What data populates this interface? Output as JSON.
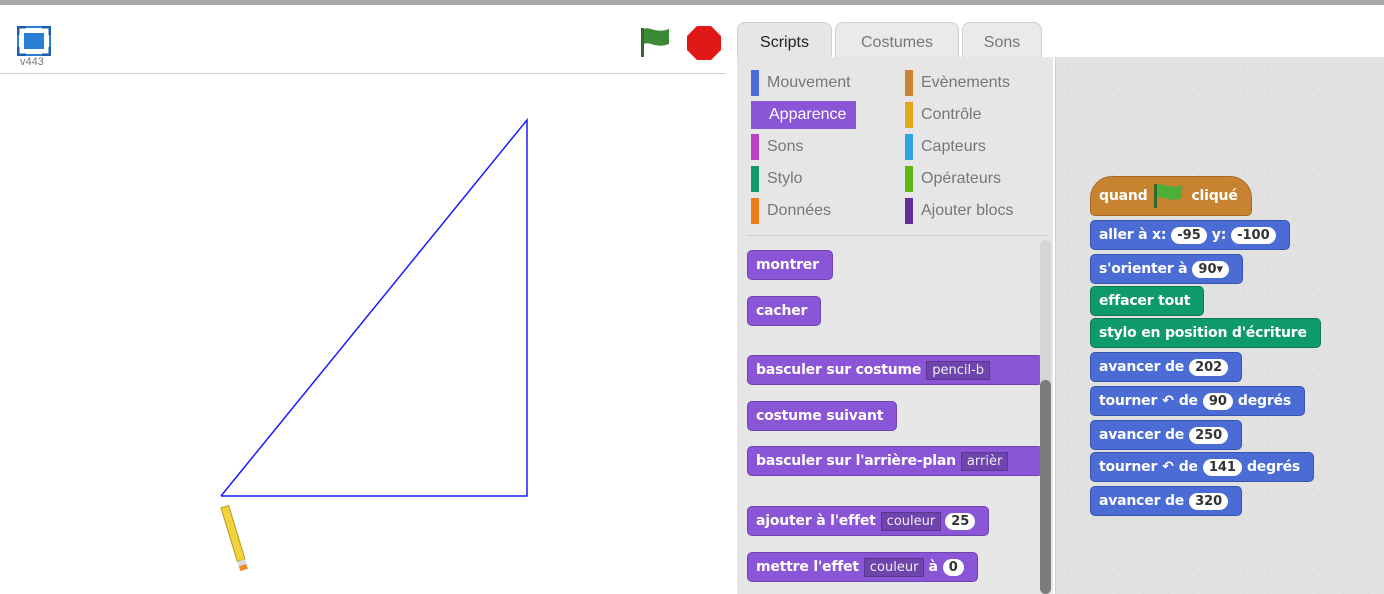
{
  "stage": {
    "version": "v443",
    "drawing_color": "#1a1aff"
  },
  "tabs": [
    {
      "label": "Scripts",
      "active": true
    },
    {
      "label": "Costumes",
      "active": false
    },
    {
      "label": "Sons",
      "active": false
    }
  ],
  "categories": {
    "left": [
      {
        "label": "Mouvement",
        "color": "#4a6cd4"
      },
      {
        "label": "Apparence",
        "color": "#8a55d7",
        "selected": true
      },
      {
        "label": "Sons",
        "color": "#bb42c3"
      },
      {
        "label": "Stylo",
        "color": "#0e9a6c"
      },
      {
        "label": "Données",
        "color": "#ee7d16"
      }
    ],
    "right": [
      {
        "label": "Evènements",
        "color": "#c88330"
      },
      {
        "label": "Contrôle",
        "color": "#e1a91a"
      },
      {
        "label": "Capteurs",
        "color": "#2ca5e2"
      },
      {
        "label": "Opérateurs",
        "color": "#5cb712"
      },
      {
        "label": "Ajouter blocs",
        "color": "#632d99"
      }
    ]
  },
  "palette": {
    "montrer": "montrer",
    "cacher": "cacher",
    "switch_costume": "basculer sur costume",
    "switch_costume_value": "pencil-b",
    "next_costume": "costume suivant",
    "switch_backdrop": "basculer sur l'arrière-plan",
    "switch_backdrop_value": "arrièr",
    "change_effect": "ajouter à l'effet",
    "change_effect_value": "couleur",
    "change_effect_amount": "25",
    "set_effect": "mettre l'effet",
    "set_effect_value": "couleur",
    "set_effect_to": "à",
    "set_effect_amount": "0"
  },
  "script": {
    "hat_when": "quand",
    "hat_clicked": "cliqué",
    "goto_label": "aller à x:",
    "goto_x": "-95",
    "goto_y_label": "y:",
    "goto_y": "-100",
    "point_label": "s'orienter à",
    "point_value": "90",
    "clear": "effacer tout",
    "pen_down": "stylo en position d'écriture",
    "move1_label": "avancer de",
    "move1_value": "202",
    "turn1_label": "tourner",
    "turn1_de": "de",
    "turn1_value": "90",
    "turn1_unit": "degrés",
    "move2_label": "avancer de",
    "move2_value": "250",
    "turn2_label": "tourner",
    "turn2_de": "de",
    "turn2_value": "141",
    "turn2_unit": "degrés",
    "move3_label": "avancer de",
    "move3_value": "320"
  }
}
